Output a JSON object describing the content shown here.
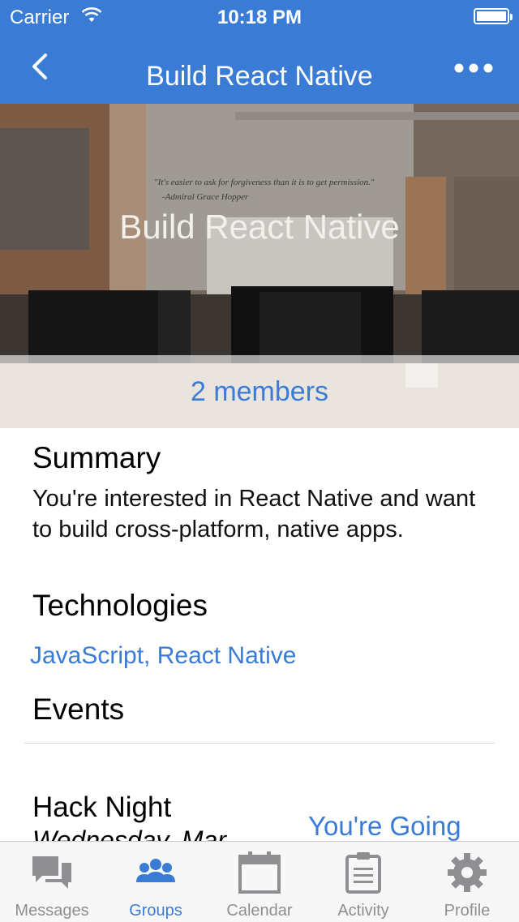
{
  "status_bar": {
    "carrier": "Carrier",
    "time": "10:18 PM"
  },
  "nav": {
    "title": "Build React Native",
    "back_icon": "chevron-left-icon",
    "more_icon": "ellipsis-icon"
  },
  "hero": {
    "title": "Build React Native",
    "members": "2 members",
    "quote": "\"It's easier to ask for forgiveness than it is to get permission.\"",
    "quote_author": "-Admiral Grace Hopper"
  },
  "summary": {
    "heading": "Summary",
    "text": "You're interested in React Native and want to build cross-platform, native apps."
  },
  "technologies": {
    "heading": "Technologies",
    "value": "JavaScript, React Native"
  },
  "events": {
    "heading": "Events",
    "items": [
      {
        "name": "Hack Night",
        "date": "Wednesday, Mar",
        "status": "You're Going"
      }
    ]
  },
  "tabs": [
    {
      "label": "Messages",
      "icon": "chat-bubbles-icon",
      "active": false
    },
    {
      "label": "Groups",
      "icon": "group-icon",
      "active": true
    },
    {
      "label": "Calendar",
      "icon": "calendar-icon",
      "active": false
    },
    {
      "label": "Activity",
      "icon": "clipboard-icon",
      "active": false
    },
    {
      "label": "Profile",
      "icon": "gear-icon",
      "active": false
    }
  ],
  "colors": {
    "accent": "#3a7bd5",
    "tab_inactive": "#8e8e93"
  }
}
